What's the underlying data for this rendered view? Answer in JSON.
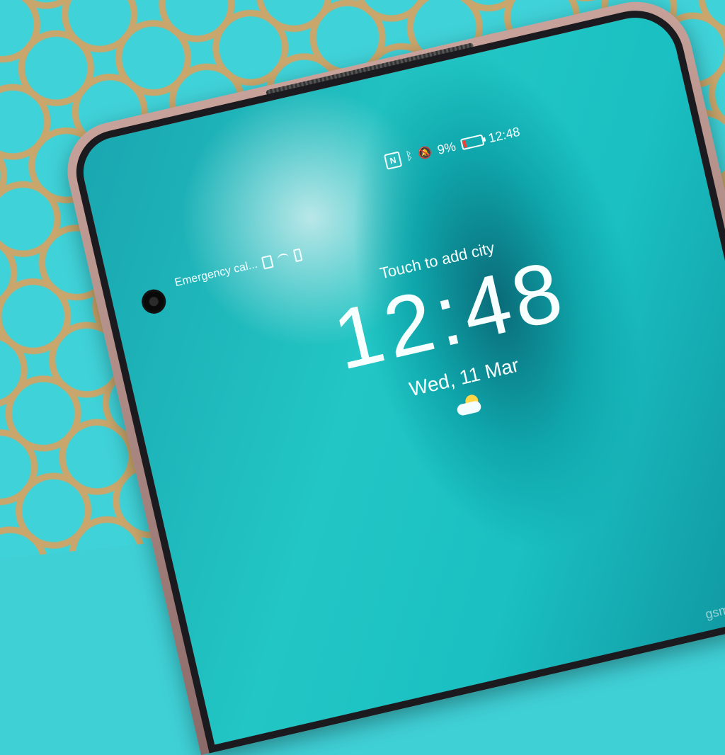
{
  "status": {
    "left_text": "Emergency cal...",
    "right_text": "9%",
    "time": "12:48",
    "icons": [
      "sim-icon",
      "wifi-icon",
      "battery-mini-icon",
      "nfc-icon",
      "bluetooth-icon",
      "bell-off-icon",
      "battery-icon"
    ]
  },
  "lockscreen": {
    "touch_city": "Touch to add city",
    "clock": "12:48",
    "date": "Wed, 11 Mar",
    "weather_icon": "partly-cloudy-icon"
  },
  "watermark": "gsmarena.com",
  "colors": {
    "screen_accent": "#1aa6b0",
    "battery_low": "#ff3b30"
  }
}
